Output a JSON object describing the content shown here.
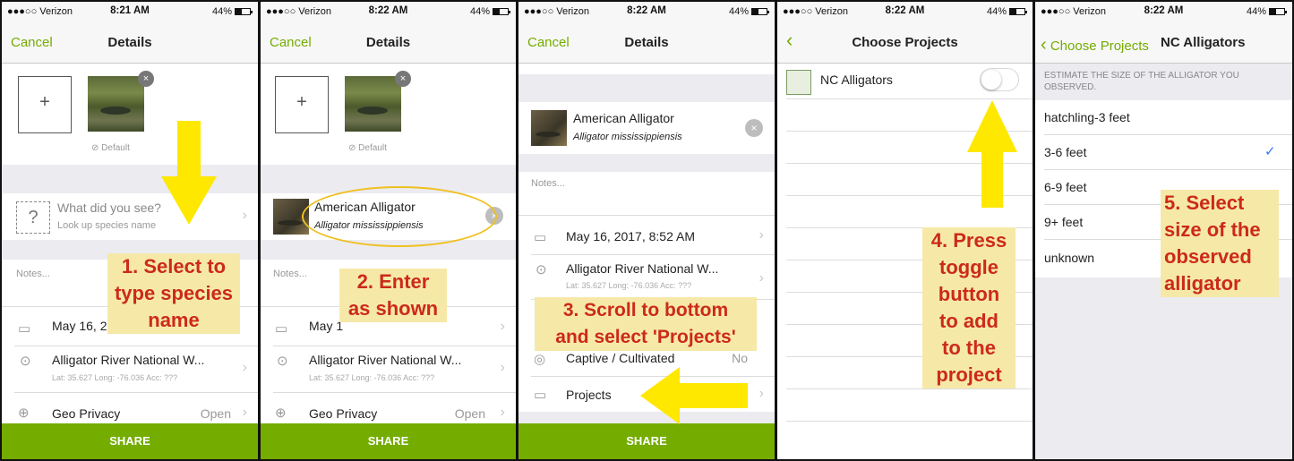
{
  "status": {
    "carrier": "●●●○○ Verizon",
    "battery": "44%",
    "time1": "8:21 AM",
    "time2": "8:22 AM"
  },
  "nav": {
    "cancel": "Cancel",
    "details": "Details",
    "choose_projects": "Choose Projects",
    "back_choose_projects": "Choose Projects",
    "nc_alligators": "NC Alligators"
  },
  "photo": {
    "default_label": "Default",
    "add_symbol": "+"
  },
  "species": {
    "question": "What did you see?",
    "lookup": "Look up species name",
    "common": "American Alligator",
    "scientific": "Alligator mississippiensis"
  },
  "notes": {
    "placeholder": "Notes..."
  },
  "observation": {
    "date": "May 16, 2017, 8:52 AM",
    "date_partial1": "May 16, 2",
    "date_partial2": "May 1",
    "place": "Alligator River National W...",
    "coords": "Lat: 35.627  Long: -76.036  Acc: ???",
    "coords_partial": "Lat: 35.627  Long: -76.036  Acc: ???"
  },
  "geoprivacy": {
    "label": "Geo Privacy",
    "value": "Open"
  },
  "captive": {
    "label": "Captive / Cultivated",
    "value": "No"
  },
  "projects": {
    "label": "Projects"
  },
  "share": {
    "label": "SHARE"
  },
  "projects_list": {
    "item": "NC Alligators"
  },
  "size_question": {
    "heading": "ESTIMATE THE SIZE OF THE ALLIGATOR YOU OBSERVED.",
    "options": [
      "hatchling-3 feet",
      "3-6 feet",
      "6-9 feet",
      "9+ feet",
      "unknown"
    ],
    "selected": "3-6 feet",
    "check": "✓"
  },
  "annotations": {
    "step1": [
      "1. Select to",
      "type species",
      "name"
    ],
    "step2": [
      "2. Enter",
      "as shown"
    ],
    "step3": [
      "3. Scroll to bottom",
      "and select 'Projects'"
    ],
    "step4": [
      "4. Press",
      "toggle",
      "button",
      "to add",
      "to the",
      "project"
    ],
    "step5": [
      "5. Select",
      "size of the",
      "observed",
      "alligator"
    ]
  },
  "colors": {
    "accent_green": "#74ac00",
    "annotation_red": "#cc2a1a",
    "annotation_bg": "#f6e9a8",
    "arrow_yellow": "#ffe800",
    "check_blue": "#3478f6"
  },
  "icons": {
    "chevron": "›",
    "back": "‹",
    "close": "×",
    "question": "?",
    "calendar": "calendar-icon",
    "pin": "location-pin-icon",
    "globe": "globe-icon",
    "folder": "folder-icon"
  }
}
